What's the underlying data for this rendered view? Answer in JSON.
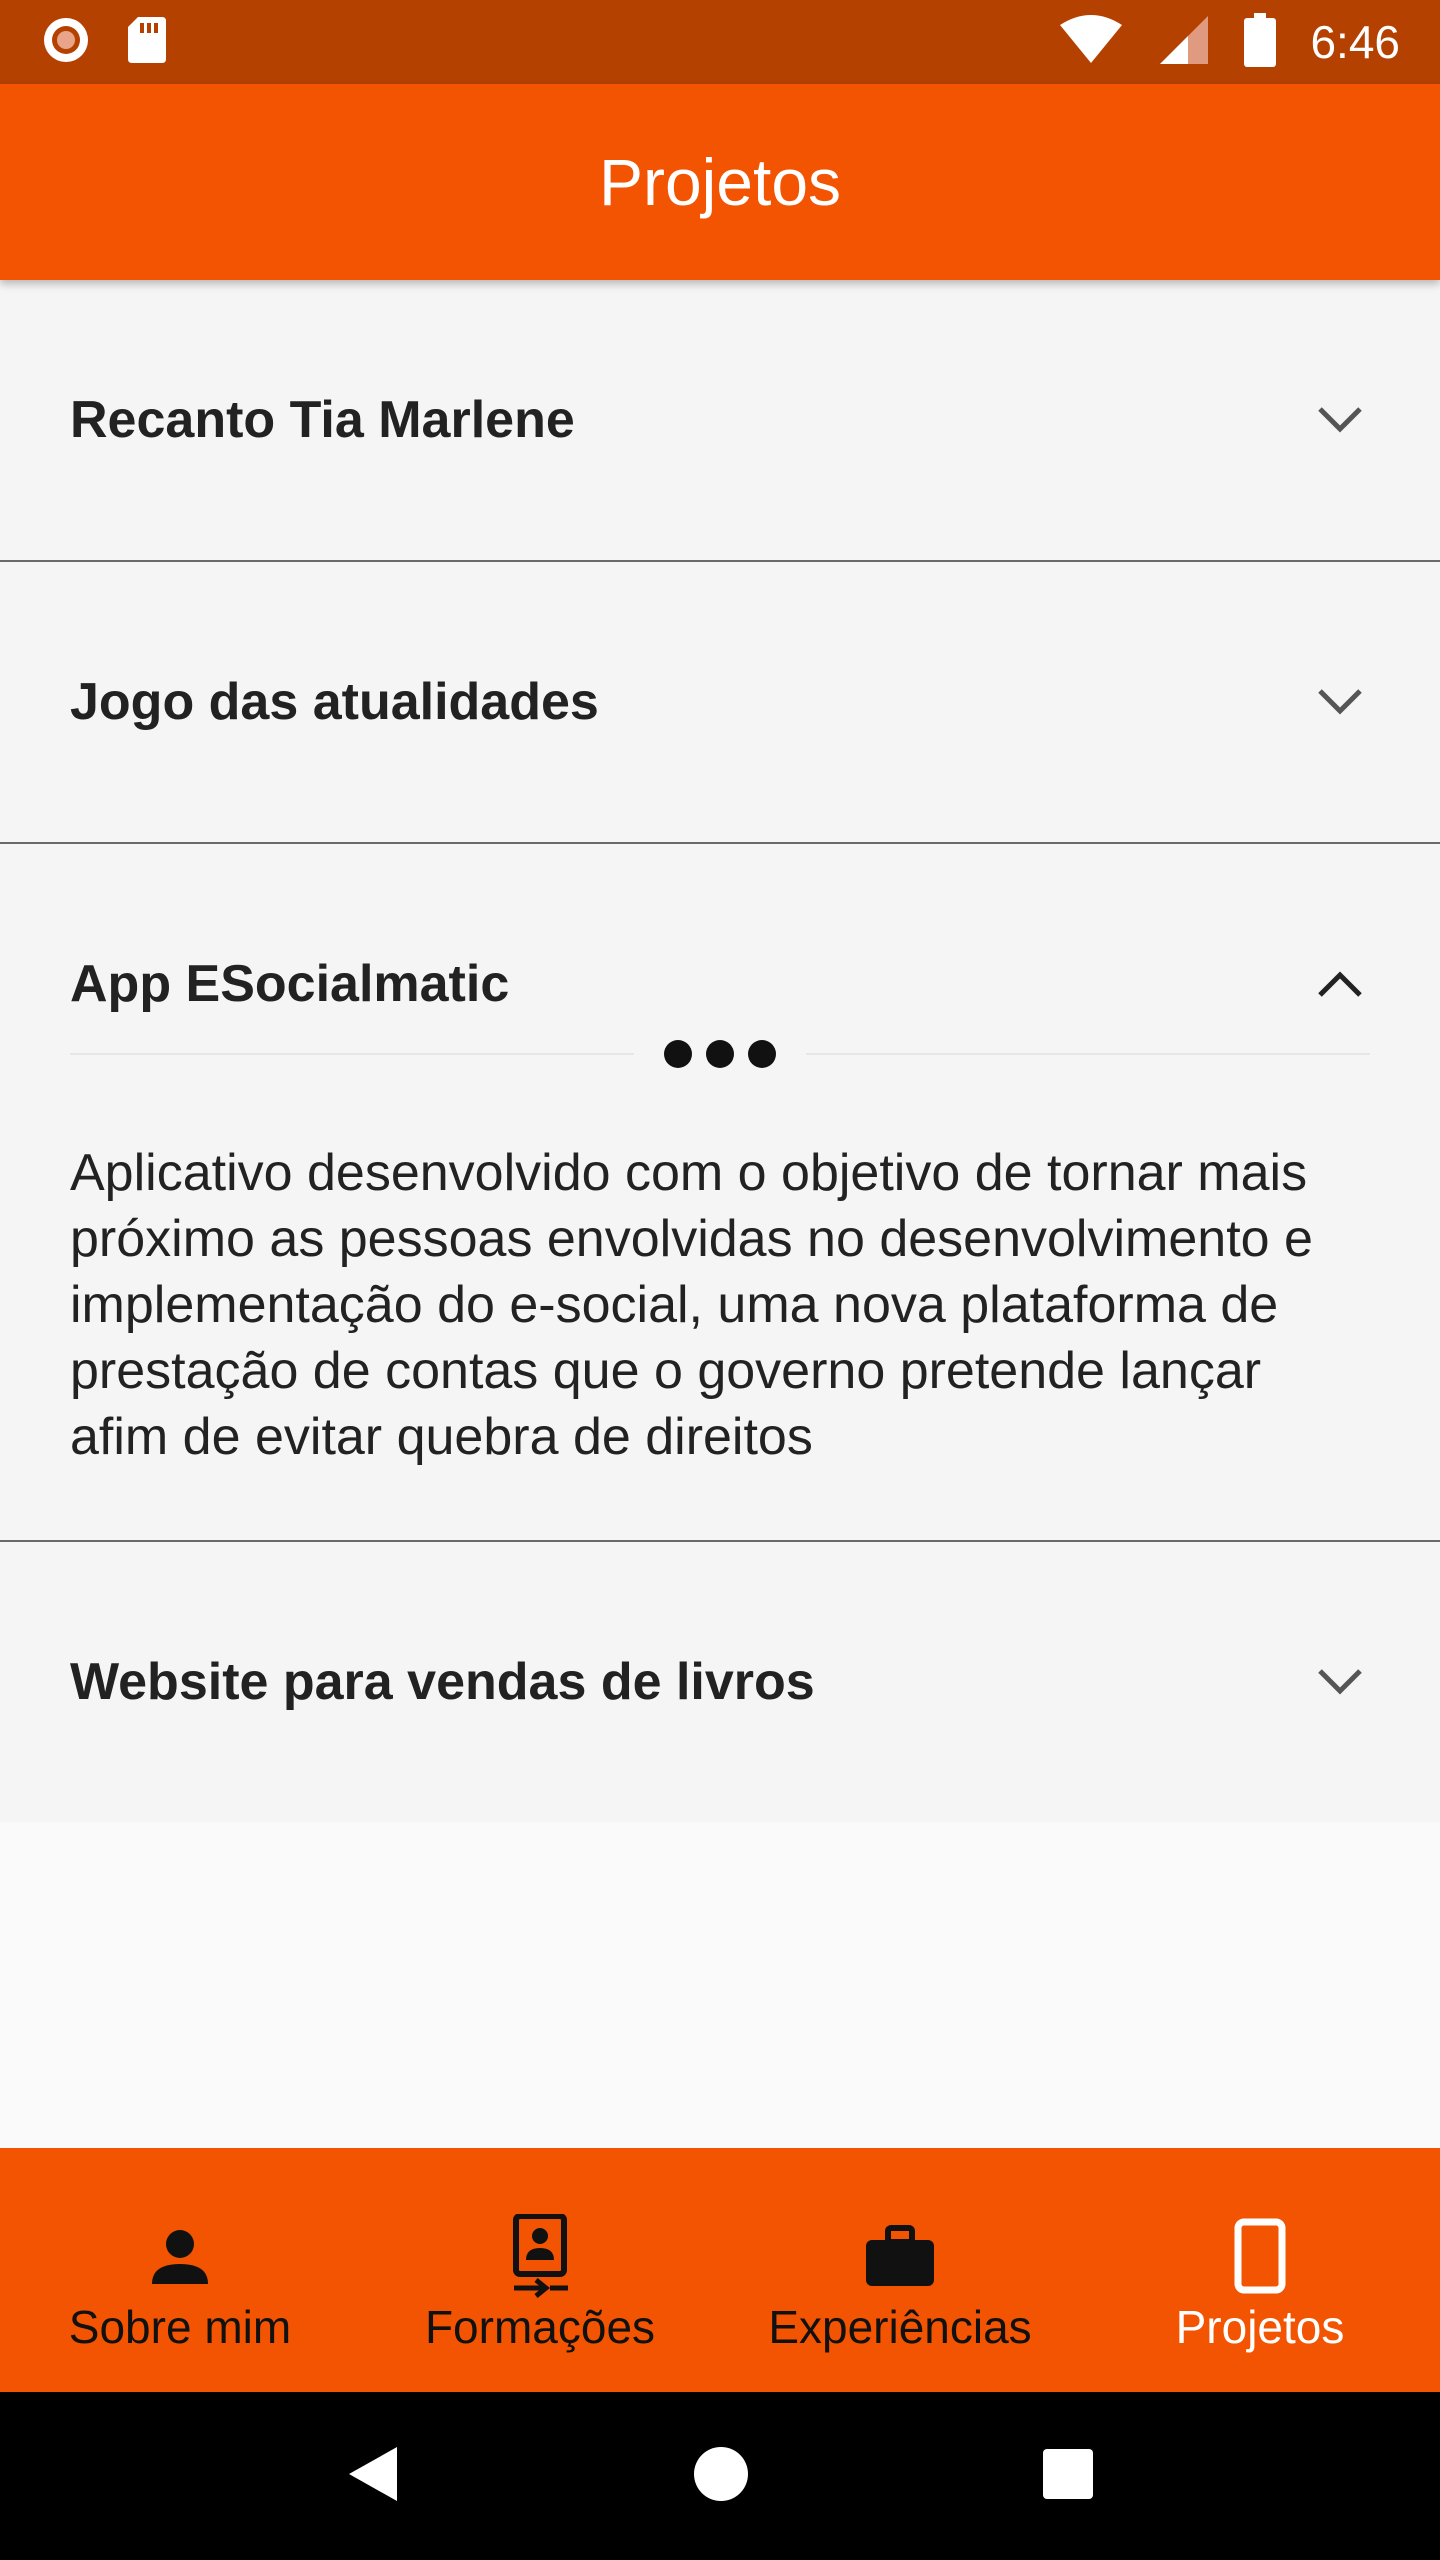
{
  "status_bar": {
    "time": "6:46",
    "icons": [
      "record-icon",
      "sd-card-icon",
      "wifi-icon",
      "signal-icon",
      "battery-icon"
    ]
  },
  "app_bar": {
    "title": "Projetos"
  },
  "projects": [
    {
      "title": "Recanto Tia Marlene",
      "expanded": false
    },
    {
      "title": "Jogo das atualidades",
      "expanded": false
    },
    {
      "title": "App ESocialmatic",
      "expanded": true,
      "description": "Aplicativo desenvolvido com o objetivo de tornar mais próximo as pessoas envolvidas no desenvolvimento e implementação do e-social, uma nova plataforma de prestação de contas que o governo pretende lançar afim de evitar quebra de direitos"
    },
    {
      "title": "Website para vendas de livros",
      "expanded": false
    }
  ],
  "bottom_nav": {
    "items": [
      {
        "label": "Sobre mim",
        "icon": "person-icon",
        "active": false
      },
      {
        "label": "Formações",
        "icon": "contact-card-icon",
        "active": false
      },
      {
        "label": "Experiências",
        "icon": "briefcase-icon",
        "active": false
      },
      {
        "label": "Projetos",
        "icon": "phone-icon",
        "active": true
      }
    ]
  },
  "colors": {
    "primary": "#f35402",
    "status_bar": "#b44100",
    "background": "#f5f5f5",
    "text": "#222222"
  }
}
